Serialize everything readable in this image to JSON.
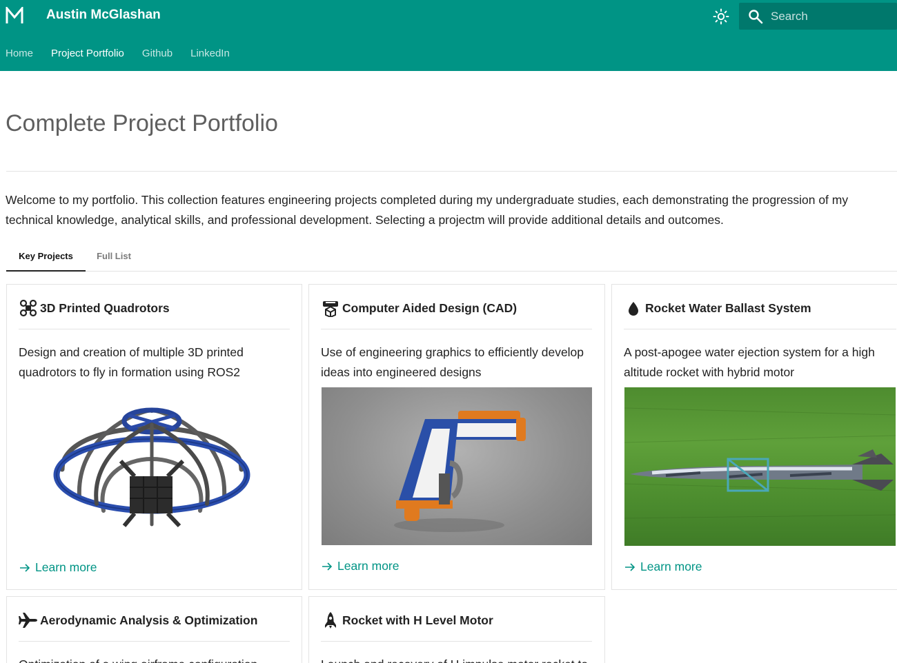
{
  "header": {
    "logo_icon": "m-logo-icon",
    "site_title": "Austin McGlashan",
    "theme_icon": "brightness-icon",
    "search": {
      "icon": "search-icon",
      "placeholder": "Search"
    },
    "nav": [
      {
        "label": "Home",
        "active": false
      },
      {
        "label": "Project Portfolio",
        "active": true
      },
      {
        "label": "Github",
        "active": false
      },
      {
        "label": "LinkedIn",
        "active": false
      }
    ]
  },
  "main": {
    "title": "Complete Project Portfolio",
    "intro": "Welcome to my portfolio. This collection features engineering projects completed during my undergraduate studies, each demonstrating the progression of my technical knowledge, analytical skills, and professional development. Selecting a projectm will provide additional details and outcomes.",
    "tabs": [
      {
        "label": "Key Projects",
        "active": true
      },
      {
        "label": "Full List",
        "active": false
      }
    ],
    "cards": [
      {
        "icon": "drone-icon",
        "title": "3D Printed Quadrotors",
        "description": "Design and creation of multiple 3D printed quadrotors to fly in formation using ROS2",
        "image": "quadrotor-cage-render",
        "link": "Learn more"
      },
      {
        "icon": "printer-3d-icon",
        "title": "Computer Aided Design (CAD)",
        "description": "Use of engineering graphics to efficiently develop ideas into engineered designs",
        "image": "nerf-jolt-render",
        "link": "Learn more"
      },
      {
        "icon": "water-drop-icon",
        "title": "Rocket Water Ballast System",
        "description": "A post-apogee water ejection system for a high altitude rocket with hybrid motor",
        "image": "rocket-on-grass-photo",
        "link": "Learn more"
      },
      {
        "icon": "airplane-icon",
        "title": "Aerodynamic Analysis & Optimization",
        "description": "Optimization of a wing airframe configuration"
      },
      {
        "icon": "rocket-icon",
        "title": "Rocket with H Level Motor",
        "description": "Launch and recovery of H impulse motor rocket to"
      }
    ]
  },
  "colors": {
    "primary": "#009485",
    "search_bg": "#00786c",
    "text": "#222222",
    "title_gray": "#5f5f5f",
    "border": "#e3e3e3"
  }
}
